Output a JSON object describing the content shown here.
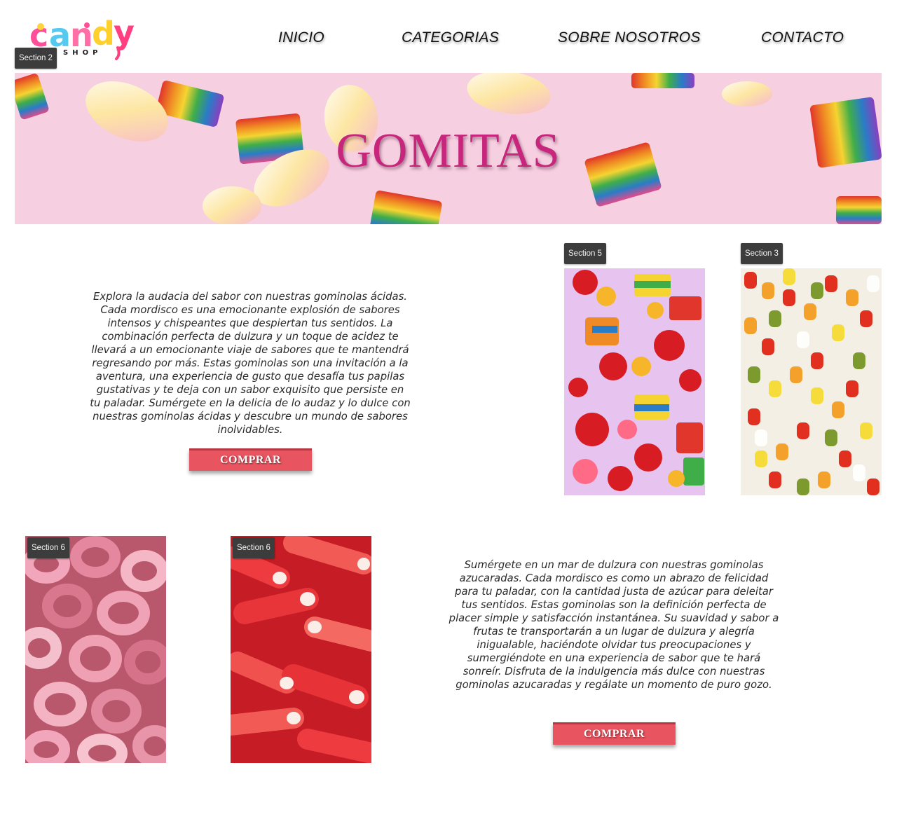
{
  "brand": {
    "logo_text": "candy",
    "logo_subtext": "SHOP"
  },
  "nav": {
    "items": [
      "INICIO",
      "CATEGORIAS",
      "SOBRE NOSOTROS",
      "CONTACTO"
    ]
  },
  "section_tags": {
    "header": "Section 2",
    "photo_gummies_mix": "Section 5",
    "photo_gummy_bears": "Section 3",
    "photo_rings": "Section 6",
    "photo_straws": "Section 6"
  },
  "hero": {
    "title": "GOMITAS"
  },
  "block_acidas": {
    "text": "Explora la audacia del sabor con nuestras gominolas ácidas. Cada mordisco es una emocionante explosión de sabores intensos y chispeantes que despiertan tus sentidos. La combinación perfecta de dulzura y un toque de acidez te llevará a un emocionante viaje de sabores que te mantendrá regresando por más. Estas gominolas son una invitación a la aventura, una experiencia de gusto que desafía tus papilas gustativas y te deja con un sabor exquisito que persiste en tu paladar. Sumérgete en la delicia de lo audaz y lo dulce con nuestras gominolas ácidas y descubre un mundo de sabores inolvidables.",
    "button": "COMPRAR"
  },
  "block_azucaradas": {
    "text": "Sumérgete en un mar de dulzura con nuestras gominolas azucaradas. Cada mordisco es como un abrazo de felicidad para tu paladar, con la cantidad justa de azúcar para deleitar tus sentidos. Estas gominolas son la definición perfecta de placer simple y satisfacción instantánea. Su suavidad y sabor a frutas te transportarán a un lugar de dulzura y alegría inigualable, haciéndote olvidar tus preocupaciones y sumergiéndote en una experiencia de sabor que te hará sonreír. Disfruta de la indulgencia más dulce con nuestras gominolas azucaradas y regálate un momento de puro gozo.",
    "button": "COMPRAR"
  },
  "colors": {
    "button": "#e8545f",
    "hero_background": "#f6cfe0",
    "hero_title": "#c8267c",
    "section_tag": "#3c3c3c"
  }
}
